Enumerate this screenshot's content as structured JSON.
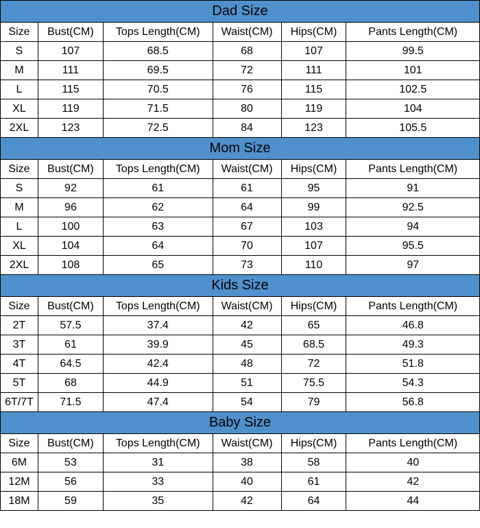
{
  "headers": {
    "size": "Size",
    "bust": "Bust(CM)",
    "tops_length": "Tops Length(CM)",
    "waist": "Waist(CM)",
    "hips": "Hips(CM)",
    "pants_length": "Pants Length(CM)"
  },
  "sections": [
    {
      "title": "Dad Size",
      "rows": [
        {
          "size": "S",
          "bust": "107",
          "tops": "68.5",
          "waist": "68",
          "hips": "107",
          "pants": "99.5"
        },
        {
          "size": "M",
          "bust": "111",
          "tops": "69.5",
          "waist": "72",
          "hips": "111",
          "pants": "101"
        },
        {
          "size": "L",
          "bust": "115",
          "tops": "70.5",
          "waist": "76",
          "hips": "115",
          "pants": "102.5"
        },
        {
          "size": "XL",
          "bust": "119",
          "tops": "71.5",
          "waist": "80",
          "hips": "119",
          "pants": "104"
        },
        {
          "size": "2XL",
          "bust": "123",
          "tops": "72.5",
          "waist": "84",
          "hips": "123",
          "pants": "105.5"
        }
      ]
    },
    {
      "title": "Mom Size",
      "rows": [
        {
          "size": "S",
          "bust": "92",
          "tops": "61",
          "waist": "61",
          "hips": "95",
          "pants": "91"
        },
        {
          "size": "M",
          "bust": "96",
          "tops": "62",
          "waist": "64",
          "hips": "99",
          "pants": "92.5"
        },
        {
          "size": "L",
          "bust": "100",
          "tops": "63",
          "waist": "67",
          "hips": "103",
          "pants": "94"
        },
        {
          "size": "XL",
          "bust": "104",
          "tops": "64",
          "waist": "70",
          "hips": "107",
          "pants": "95.5"
        },
        {
          "size": "2XL",
          "bust": "108",
          "tops": "65",
          "waist": "73",
          "hips": "110",
          "pants": "97"
        }
      ]
    },
    {
      "title": "Kids Size",
      "rows": [
        {
          "size": "2T",
          "bust": "57.5",
          "tops": "37.4",
          "waist": "42",
          "hips": "65",
          "pants": "46.8"
        },
        {
          "size": "3T",
          "bust": "61",
          "tops": "39.9",
          "waist": "45",
          "hips": "68.5",
          "pants": "49.3"
        },
        {
          "size": "4T",
          "bust": "64.5",
          "tops": "42.4",
          "waist": "48",
          "hips": "72",
          "pants": "51.8"
        },
        {
          "size": "5T",
          "bust": "68",
          "tops": "44.9",
          "waist": "51",
          "hips": "75.5",
          "pants": "54.3"
        },
        {
          "size": "6T/7T",
          "bust": "71.5",
          "tops": "47.4",
          "waist": "54",
          "hips": "79",
          "pants": "56.8"
        }
      ]
    },
    {
      "title": "Baby Size",
      "rows": [
        {
          "size": "6M",
          "bust": "53",
          "tops": "31",
          "waist": "38",
          "hips": "58",
          "pants": "40"
        },
        {
          "size": "12M",
          "bust": "56",
          "tops": "33",
          "waist": "40",
          "hips": "61",
          "pants": "42"
        },
        {
          "size": "18M",
          "bust": "59",
          "tops": "35",
          "waist": "42",
          "hips": "64",
          "pants": "44"
        }
      ]
    }
  ]
}
